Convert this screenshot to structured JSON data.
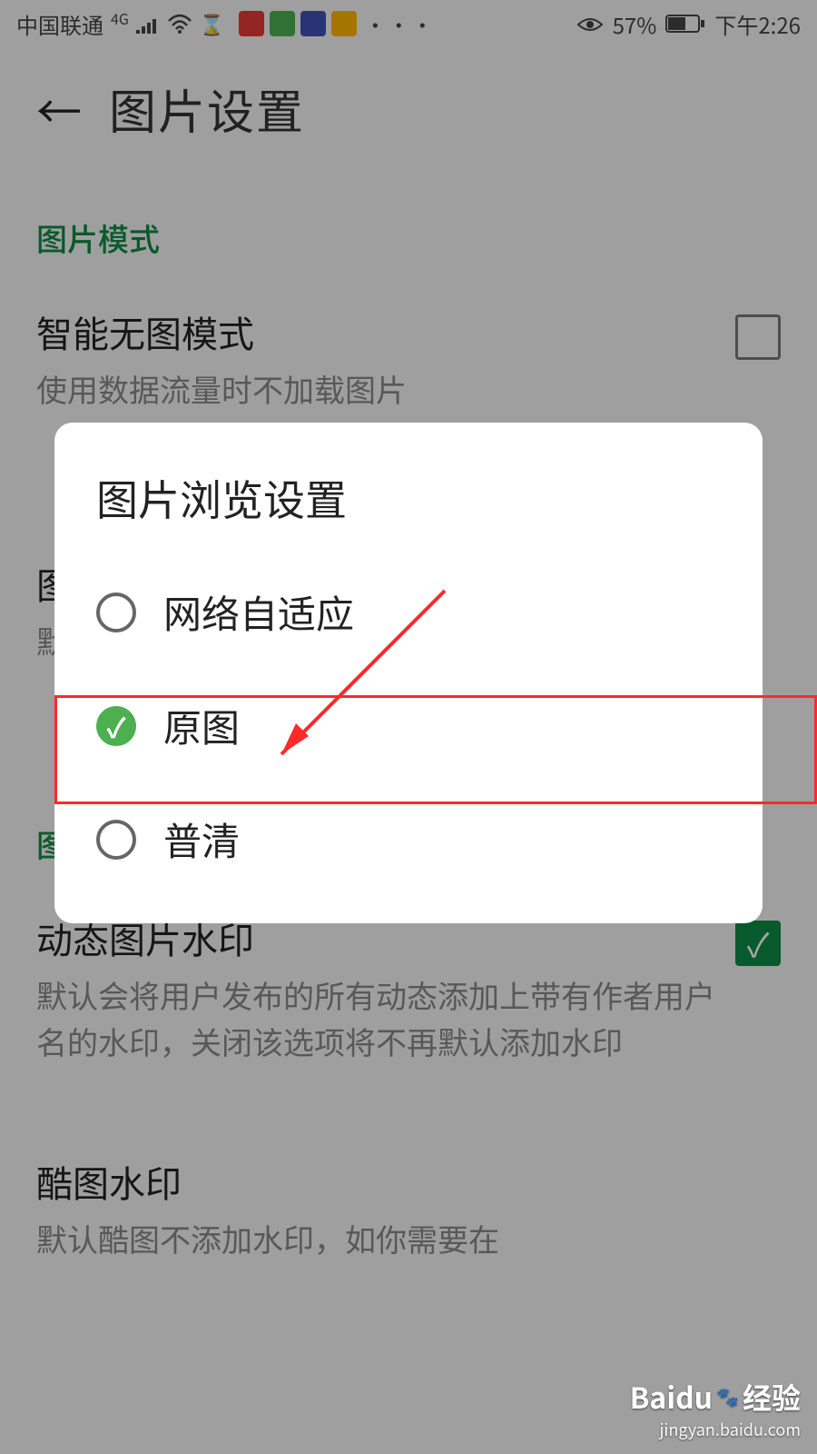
{
  "status": {
    "carrier": "中国联通",
    "network_badge": "4G",
    "battery_text": "57%",
    "time": "下午2:26",
    "ellipsis": "···"
  },
  "header": {
    "back_glyph": "←",
    "title": "图片设置"
  },
  "sections": {
    "image_mode_header": "图片模式",
    "no_image": {
      "title": "智能无图模式",
      "desc": "使用数据流量时不加载图片"
    },
    "image_watermark_header": "图",
    "dynamic_watermark": {
      "title": "动态图片水印",
      "desc": "默认会将用户发布的所有动态添加上带有作者用户名的水印，关闭该选项将不再默认添加水印"
    },
    "cool_watermark": {
      "title": "酷图水印",
      "desc": "默认酷图不添加水印，如你需要在"
    }
  },
  "dialog": {
    "title": "图片浏览设置",
    "options": [
      {
        "label": "网络自适应",
        "selected": false
      },
      {
        "label": "原图",
        "selected": true
      },
      {
        "label": "普清",
        "selected": false
      }
    ]
  },
  "watermark": {
    "brand": "Baidu",
    "suffix": "经验",
    "url": "jingyan.baidu.com"
  },
  "colors": {
    "accent": "#0b8a42",
    "annotation": "#ff2a2a"
  }
}
